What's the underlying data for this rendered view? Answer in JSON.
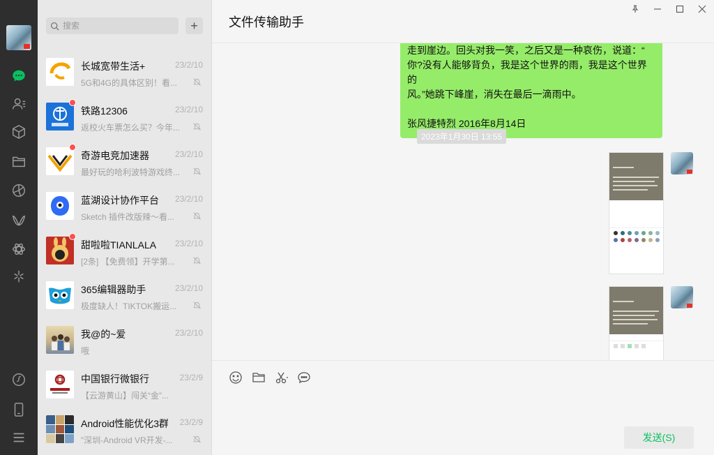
{
  "search": {
    "placeholder": "搜索"
  },
  "add_label": "+",
  "colors": {
    "rail_bg": "#2e2e2e",
    "accent_green": "#07c160",
    "bubble_green": "#95ec69",
    "unread_red": "#fa5151"
  },
  "rail": {
    "icons": [
      "chat-icon",
      "contacts-icon",
      "favorites-icon",
      "files-icon",
      "moments-icon",
      "channels-icon",
      "search-discover-icon",
      "miniprogram-icon",
      "miniprogram-panel-icon",
      "phone-icon",
      "menu-icon"
    ]
  },
  "chats": [
    {
      "name": "长城宽带生活+",
      "time": "23/2/10",
      "preview": "5G和4G的具体区别！看...",
      "unread": false
    },
    {
      "name": "铁路12306",
      "time": "23/2/10",
      "preview": "返校火车票怎么买？今年...",
      "unread": true
    },
    {
      "name": "奇游电竞加速器",
      "time": "23/2/10",
      "preview": "最好玩的哈利波特游戏终...",
      "unread": true
    },
    {
      "name": "蓝湖设计协作平台",
      "time": "23/2/10",
      "preview": "Sketch 插件改版辣～看...",
      "unread": false
    },
    {
      "name": "甜啦啦TIANLALA",
      "time": "23/2/10",
      "preview": "[2条] 【免费领】开学第...",
      "unread": true
    },
    {
      "name": "365编辑器助手",
      "time": "23/2/10",
      "preview": "极度缺人！TIKTOK搬运...",
      "unread": false
    },
    {
      "name": "我@的~爱",
      "time": "23/2/10",
      "preview": "哦",
      "unread": false
    },
    {
      "name": "中国银行微银行",
      "time": "23/2/9",
      "preview": "【云游黄山】闯关“金”...",
      "unread": false
    },
    {
      "name": "Android性能优化3群",
      "time": "23/2/9",
      "preview": "\"深圳-Android VR开发-...",
      "unread": false
    }
  ],
  "header": {
    "title": "文件传输助手"
  },
  "messages": {
    "text_bubble": {
      "lines": [
        "走到崖边。回头对我一笑，之后又是一种哀伤，说道：“",
        "你?没有人能够背负，我是这个世界的雨，我是这个世界的",
        "风。”她跳下峰崖，消失在最后一滴雨中。"
      ],
      "signature": "张风捷特烈 2016年8月14日"
    },
    "timestamp": "2023年1月30日 13:55"
  },
  "input": {
    "send_label": "发送(S)"
  }
}
